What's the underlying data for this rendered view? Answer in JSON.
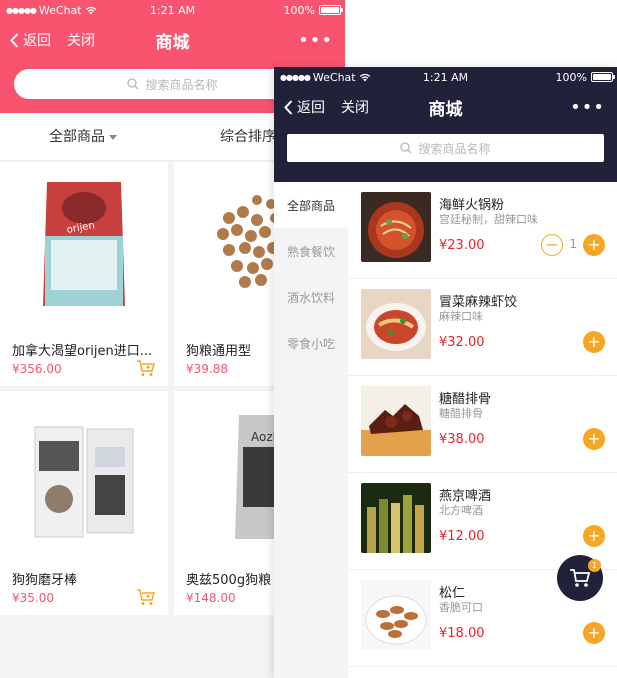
{
  "back_phone": {
    "status": {
      "carrier": "WeChat",
      "time": "1:21 AM",
      "battery": "100%"
    },
    "nav": {
      "back_label": "返回",
      "close_label": "关闭",
      "title": "商城",
      "more": "•••"
    },
    "search": {
      "placeholder": "搜索商品名称"
    },
    "filters": {
      "all_label": "全部商品",
      "sort_label": "综合排序"
    },
    "products": [
      {
        "name": "加拿大渴望orijen进口...",
        "price": "¥356.00"
      },
      {
        "name": "狗粮通用型",
        "price": "¥39.88"
      },
      {
        "name": "狗狗磨牙棒",
        "price": "¥35.00"
      },
      {
        "name": "奥兹500g狗粮",
        "price": "¥148.00"
      }
    ],
    "colors": {
      "brand": "#f8536f",
      "cart_icon": "#f5a623"
    }
  },
  "front_phone": {
    "status": {
      "carrier": "WeChat",
      "time": "1:21 AM",
      "battery": "100%"
    },
    "nav": {
      "back_label": "返回",
      "close_label": "关闭",
      "title": "商城",
      "more": "•••"
    },
    "search": {
      "placeholder": "搜索商品名称"
    },
    "categories": [
      "全部商品",
      "熟食餐饮",
      "酒水饮料",
      "零食小吃"
    ],
    "active_category": "全部商品",
    "items": [
      {
        "name": "海鲜火锅粉",
        "desc": "宫廷秘制，甜辣口味",
        "price": "¥23.00",
        "qty": "1"
      },
      {
        "name": "冒菜麻辣虾饺",
        "desc": "麻辣口味",
        "price": "¥32.00"
      },
      {
        "name": "糖醋排骨",
        "desc": "糖醋排骨",
        "price": "¥38.00"
      },
      {
        "name": "燕京啤酒",
        "desc": "北方啤酒",
        "price": "¥12.00"
      },
      {
        "name": "松仁",
        "desc": "香脆可口",
        "price": "¥18.00"
      }
    ],
    "cart_badge": "1",
    "colors": {
      "brand": "#22213a",
      "accent": "#f5a623",
      "price": "#e8242c"
    }
  }
}
